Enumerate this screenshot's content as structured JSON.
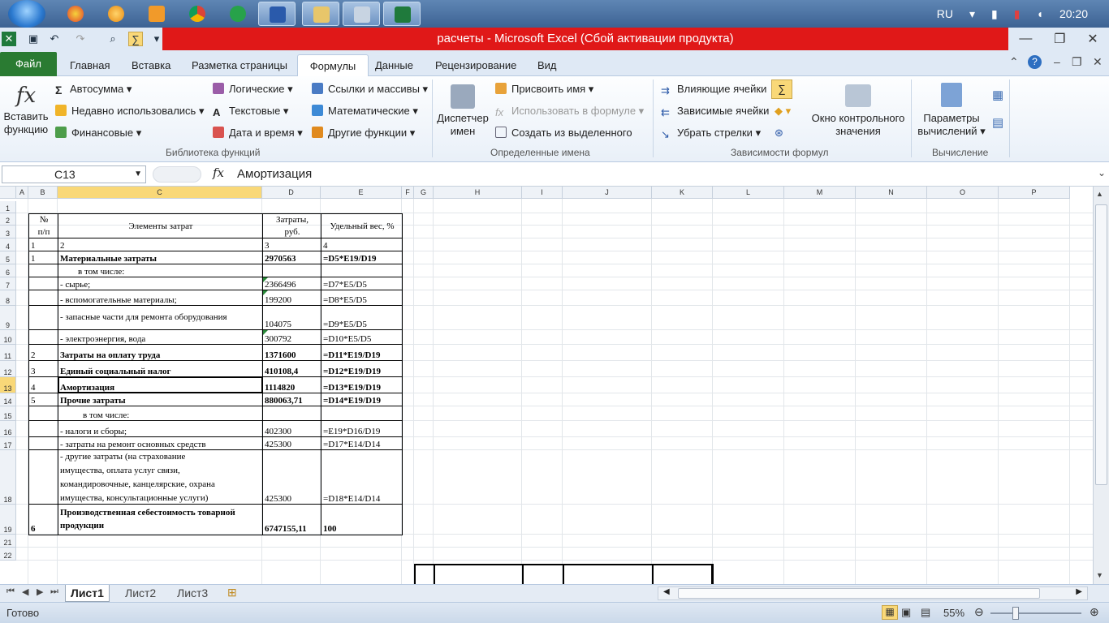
{
  "taskbar": {
    "lang": "RU",
    "time": "20:20"
  },
  "window": {
    "title": "расчеты  -  Microsoft Excel (Сбой активации продукта)"
  },
  "tabs": {
    "file": "Файл",
    "home": "Главная",
    "insert": "Вставка",
    "layout": "Разметка страницы",
    "formulas": "Формулы",
    "data": "Данные",
    "review": "Рецензирование",
    "view": "Вид"
  },
  "ribbon": {
    "insert_fn": "Вставить",
    "insert_fn2": "функцию",
    "autosum": "Автосумма",
    "recent": "Недавно использовались",
    "financial": "Финансовые",
    "logical": "Логические",
    "text": "Текстовые",
    "datetime": "Дата и время",
    "lookup": "Ссылки и массивы",
    "math": "Математические",
    "other": "Другие функции",
    "group_library": "Библиотека функций",
    "name_mgr": "Диспетчер",
    "name_mgr2": "имен",
    "assign_name": "Присвоить имя",
    "use_in_formula": "Использовать в формуле",
    "create_from_sel": "Создать из выделенного",
    "group_names": "Определенные имена",
    "trace_prec": "Влияющие ячейки",
    "trace_dep": "Зависимые ячейки",
    "remove_arrows": "Убрать стрелки",
    "watch": "Окно контрольного",
    "watch2": "значения",
    "group_audit": "Зависимости формул",
    "calc_opts": "Параметры",
    "calc_opts2": "вычислений",
    "group_calc": "Вычисление"
  },
  "formula_bar": {
    "name": "C13",
    "fx": "fx",
    "content": "Амортизация"
  },
  "columns": [
    "A",
    "B",
    "C",
    "D",
    "E",
    "F",
    "G",
    "H",
    "I",
    "J",
    "K",
    "L",
    "M",
    "N",
    "O",
    "P"
  ],
  "rows": [
    "1",
    "2",
    "3",
    "4",
    "5",
    "6",
    "7",
    "8",
    "9",
    "10",
    "11",
    "12",
    "13",
    "14",
    "15",
    "16",
    "17",
    "18",
    "19",
    "21",
    "22"
  ],
  "cells": {
    "h_num": "№",
    "h_pp": "п/п",
    "h_elem": "Элементы затрат",
    "h_cost1": "Затраты,",
    "h_cost2": "руб.",
    "h_share": "Удельный вес, %",
    "n1": "1",
    "n2": "2",
    "n3": "3",
    "n4": "4",
    "r5a": "1",
    "r5c": "Материальные затраты",
    "r5d": "2970563",
    "r5e": "=D5*E19/D19",
    "r6c": "в том числе:",
    "r7c": "- сырье;",
    "r7d": "2366496",
    "r7e": "=D7*E5/D5",
    "r8c": "- вспомогательные материалы;",
    "r8d": "199200",
    "r8e": "=D8*E5/D5",
    "r9c": "- запасные части для ремонта оборудования",
    "r9d": "104075",
    "r9e": "=D9*E5/D5",
    "r10c": "- электроэнергия, вода",
    "r10d": "300792",
    "r10e": "=D10*E5/D5",
    "r11a": "2",
    "r11c": "Затраты на оплату труда",
    "r11d": "1371600",
    "r11e": "=D11*E19/D19",
    "r12a": "3",
    "r12c": "Единый социальный налог",
    "r12d": "410108,4",
    "r12e": "=D12*E19/D19",
    "r13a": "4",
    "r13c": "Амортизация",
    "r13d": "1114820",
    "r13e": "=D13*E19/D19",
    "r14a": "5",
    "r14c": "Прочие затраты",
    "r14d": "880063,71",
    "r14e": "=D14*E19/D19",
    "r15c": "в том числе:",
    "r16c": " - налоги и сборы;",
    "r16d": "402300",
    "r16e": "=E19*D16/D19",
    "r17c": " - затраты на ремонт основных средств",
    "r17d": "425300",
    "r17e": "=D17*E14/D14",
    "r18c1": "   -   другие   затраты   (на  страхование",
    "r18c2": "имущества,    оплата    услуг    связи,",
    "r18c3": "командировочные,   канцелярские,  охрана",
    "r18c4": "имущества, консультационные услуги)",
    "r18d": "425300",
    "r18e": "=D18*E14/D14",
    "r19a": "6",
    "r19c1": "Производственная себестоимость товарной",
    "r19c2": "продукции",
    "r19d": "6747155,11",
    "r19e": "100"
  },
  "sheets": [
    "Лист1",
    "Лист2",
    "Лист3"
  ],
  "status": {
    "ready": "Готово",
    "zoom": "55%"
  }
}
